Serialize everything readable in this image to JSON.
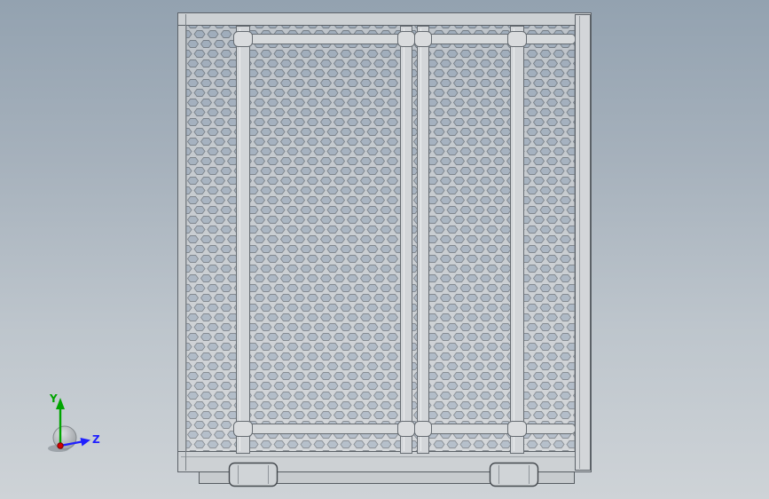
{
  "scene": {
    "type": "3d-cad-viewport",
    "background_top_color": "#93a2b0",
    "background_bottom_color": "#ced3d7"
  },
  "model": {
    "metal_color": "#ced1d4",
    "hole_color": "#a7b3c1",
    "outline_color": "#70767d",
    "frame_color": "#cdd1d4",
    "rail_color": "#d3d6d9",
    "brace_color": "#d7dadc",
    "foot_color": "#d0d4d7"
  },
  "triad": {
    "y_label": "Y",
    "z_label": "Z",
    "y_axis_color": "#00a400",
    "z_axis_color": "#2020ff",
    "origin_dot_color": "#d40000",
    "sphere_color": "#c2c6ca"
  }
}
